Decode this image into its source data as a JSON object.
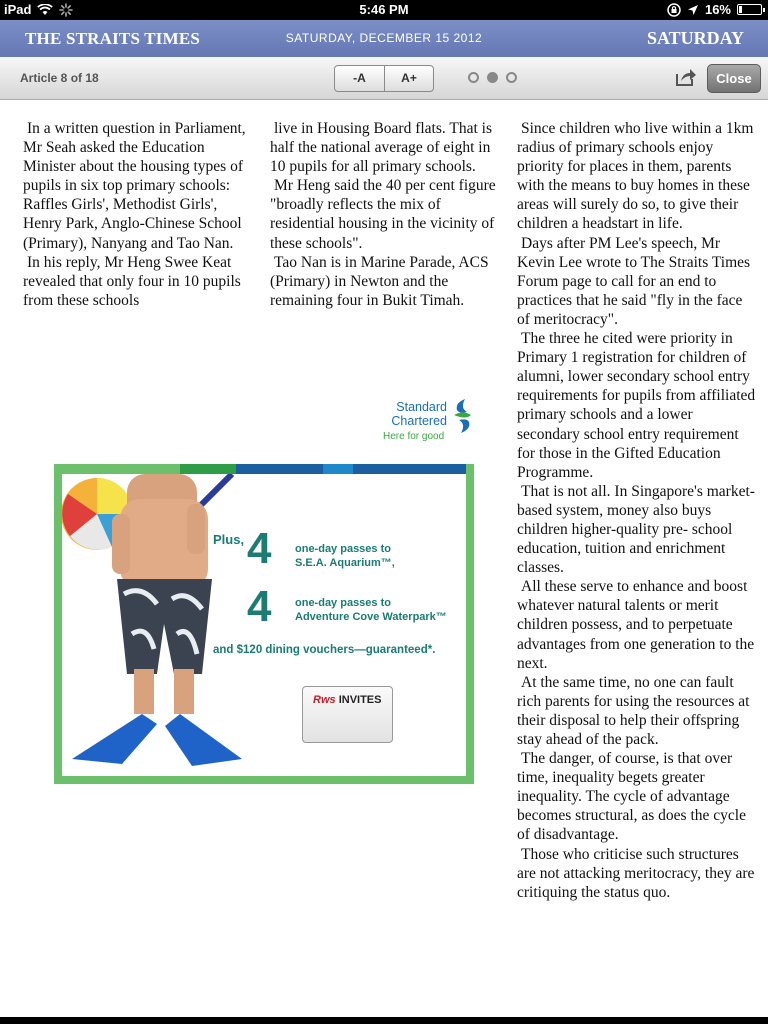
{
  "status_bar": {
    "device": "iPad",
    "time": "5:46 PM",
    "battery": "16%",
    "battery_level": 0.16
  },
  "masthead": {
    "title": "THE STRAITS TIMES",
    "date": "SATURDAY, DECEMBER 15 2012",
    "day": "SATURDAY"
  },
  "toolbar": {
    "article_count": "Article 8 of 18",
    "font_smaller": "-A",
    "font_larger": "A+",
    "close": "Close",
    "page_dots": 3,
    "active_dot": 2
  },
  "article": {
    "col1": [
      "In a written question in Parliament, Mr Seah asked the Education Minister about the housing types of pupils in six top primary schools: Raffles Girls', Methodist Girls', Henry Park, Anglo-Chinese School (Primary), Nanyang and Tao Nan.",
      "In his reply, Mr Heng Swee Keat revealed that only four in 10 pupils from these schools"
    ],
    "col2": [
      "live in Housing Board flats. That is half the national average of eight in 10 pupils for all primary schools.",
      "Mr Heng said the 40 per cent figure \"broadly reflects the mix of residential housing in the vicinity of these schools\".",
      "Tao Nan is in Marine Parade, ACS (Primary) in Newton and the remaining four in Bukit Timah."
    ],
    "col3": [
      "Since children who live within a 1km radius of primary schools enjoy priority for places in them, parents with the means to buy homes in these areas will surely do so, to give their children a headstart in life.",
      "Days after PM Lee's speech, Mr Kevin Lee wrote to The Straits Times Forum page to call for an end to practices that he said \"fly in the face of meritocracy\".",
      "The three he cited were priority in Primary 1 registration for children of alumni, lower secondary school entry requirements for pupils from affiliated primary schools and a lower secondary school entry requirement for those in the Gifted Education Programme.",
      "That is not all. In Singapore's market-based system, money also buys children higher-quality pre- school education, tuition and enrichment classes.",
      "All these serve to enhance and boost whatever natural talents or merit children possess, and to perpetuate advantages from one generation to the next.",
      "At the same time, no one can fault rich parents for using the resources at their disposal to help their offspring stay ahead of the pack.",
      "The danger, of course, is that over time, inequality begets greater inequality. The cycle of advantage becomes structural, as does the cycle of disadvantage.",
      "Those who criticise such structures are not attacking meritocracy, they are critiquing the status quo."
    ]
  },
  "ad": {
    "brand_line1": "Standard",
    "brand_line2": "Chartered",
    "tagline": "Here for good",
    "plus": "Plus,",
    "num1": "4",
    "pass1_line1": "one-day passes to",
    "pass1_line2": "S.E.A. Aquarium™,",
    "num2": "4",
    "pass2_line1": "one-day passes to",
    "pass2_line2": "Adventure Cove Waterpark™",
    "dining": "and $120 dining vouchers—guaranteed*.",
    "card_brand": "Rws",
    "card_word": "INVITES",
    "colors": {
      "teal": "#1a7c73",
      "green": "#6cc06c",
      "blue": "#1b6fb5"
    }
  }
}
